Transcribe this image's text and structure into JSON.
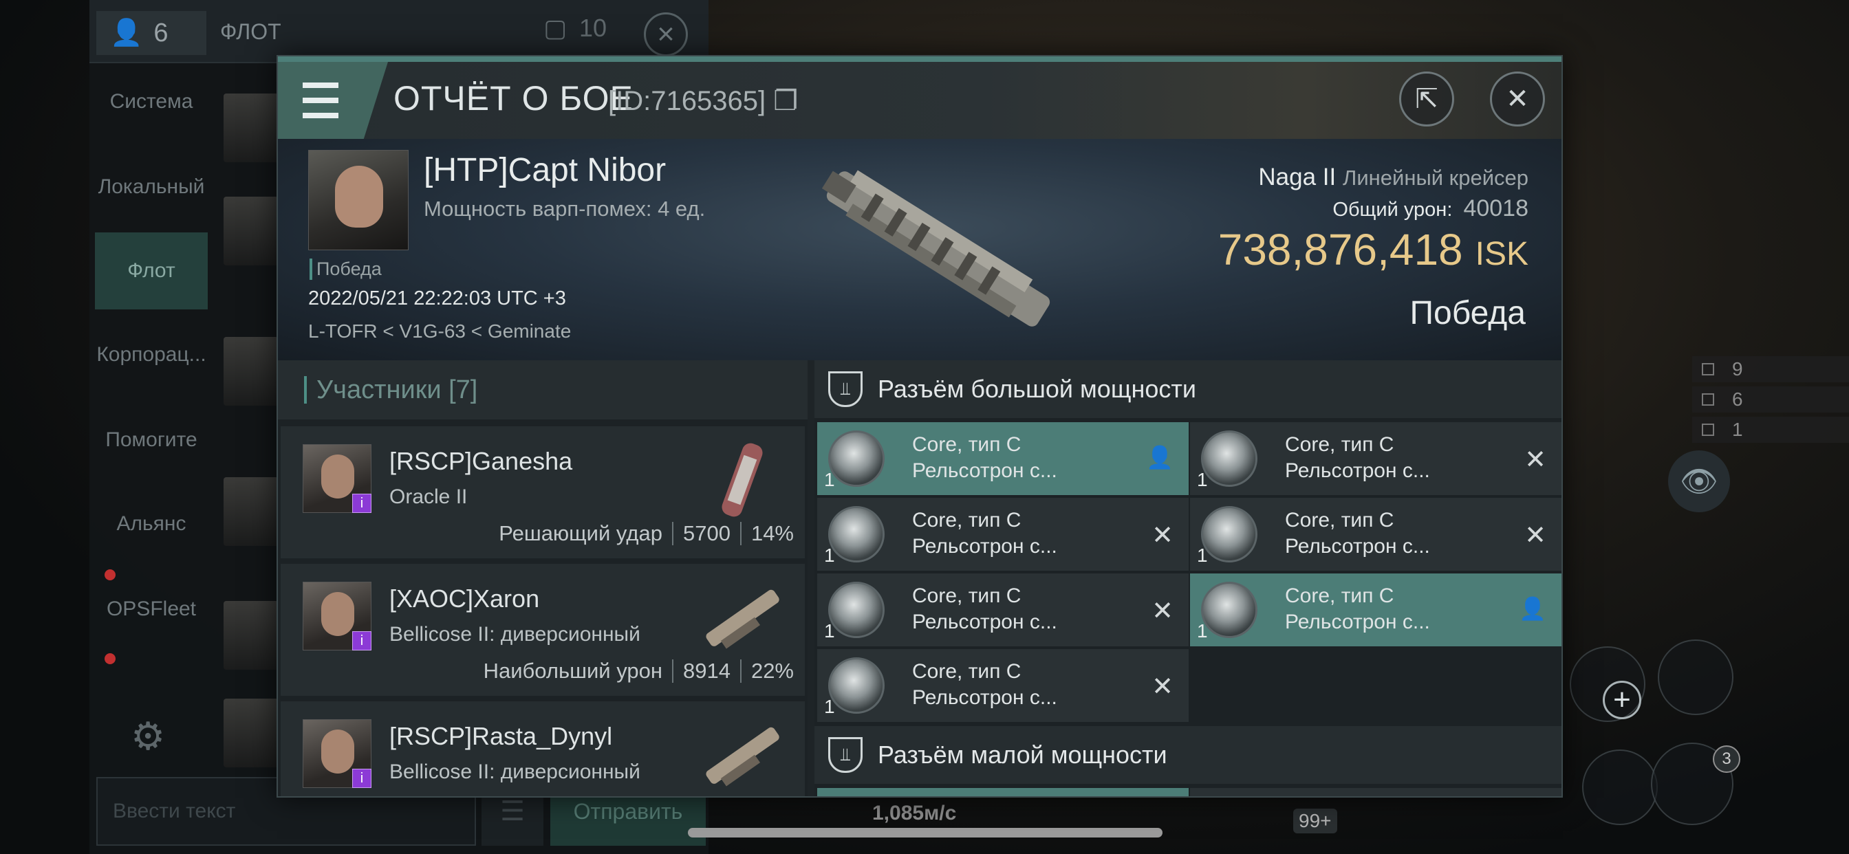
{
  "background": {
    "member_count": "6",
    "fleet_title": "ФЛОТ",
    "fleet_members": "10",
    "tabs": [
      "Система",
      "Локальный",
      "Флот",
      "Корпорац...",
      "Помогите",
      "Альянс",
      "OPSFleet"
    ],
    "input_placeholder": "Ввести текст",
    "send_label": "Отправить",
    "speed": "1,085м/с",
    "hud": [
      "9",
      "6",
      "1"
    ],
    "badge_count": "3",
    "notif_count": "99+"
  },
  "report": {
    "title": "ОТЧЁТ О БОЕ",
    "id": "[ID:7165365]",
    "pilot": "[HTP]Capt Nibor",
    "warp_disrupt": "Мощность варп-помех: 4 ед.",
    "result_small": "Победа",
    "datetime": "2022/05/21 22:22:03 UTC +3",
    "location": "L-TOFR < V1G-63 < Geminate",
    "ship_name": "Naga II",
    "ship_class": "Линейный крейсер",
    "damage_label": "Общий урон:",
    "damage_value": "40018",
    "isk_value": "738,876,418",
    "isk_currency": "ISK",
    "result_big": "Победа"
  },
  "participants": {
    "header": "Участники [7]",
    "rows": [
      {
        "name": "[RSCP]Ganesha",
        "ship": "Oracle II",
        "stat_label": "Решающий удар",
        "damage": "5700",
        "percent": "14%"
      },
      {
        "name": "[XAOC]Xaron",
        "ship": "Bellicose II: диверсионный",
        "stat_label": "Наибольший урон",
        "damage": "8914",
        "percent": "22%"
      },
      {
        "name": "[RSCP]Rasta_Dynyl",
        "ship": "Bellicose II: диверсионный",
        "stat_label": "",
        "damage": "",
        "percent": ""
      }
    ]
  },
  "fitting": {
    "high_slot_header": "Разъём большой мощности",
    "low_slot_header": "Разъём малой мощности",
    "modules": [
      {
        "name": "Core, тип C",
        "sub": "Рельсотрон с...",
        "qty": "1",
        "status": "dropped"
      },
      {
        "name": "Core, тип C",
        "sub": "Рельсотрон с...",
        "qty": "1",
        "status": "destroyed"
      },
      {
        "name": "Core, тип C",
        "sub": "Рельсотрон с...",
        "qty": "1",
        "status": "destroyed"
      },
      {
        "name": "Core, тип C",
        "sub": "Рельсотрон с...",
        "qty": "1",
        "status": "destroyed"
      },
      {
        "name": "Core, тип C",
        "sub": "Рельсотрон с...",
        "qty": "1",
        "status": "destroyed"
      },
      {
        "name": "Core, тип C",
        "sub": "Рельсотрон с...",
        "qty": "1",
        "status": "dropped"
      },
      {
        "name": "Core, тип C",
        "sub": "Рельсотрон с...",
        "qty": "1",
        "status": "destroyed"
      }
    ]
  },
  "colors": {
    "accent": "#4d7f79",
    "isk": "#e7c98a",
    "highlight": "#4c7d77"
  }
}
